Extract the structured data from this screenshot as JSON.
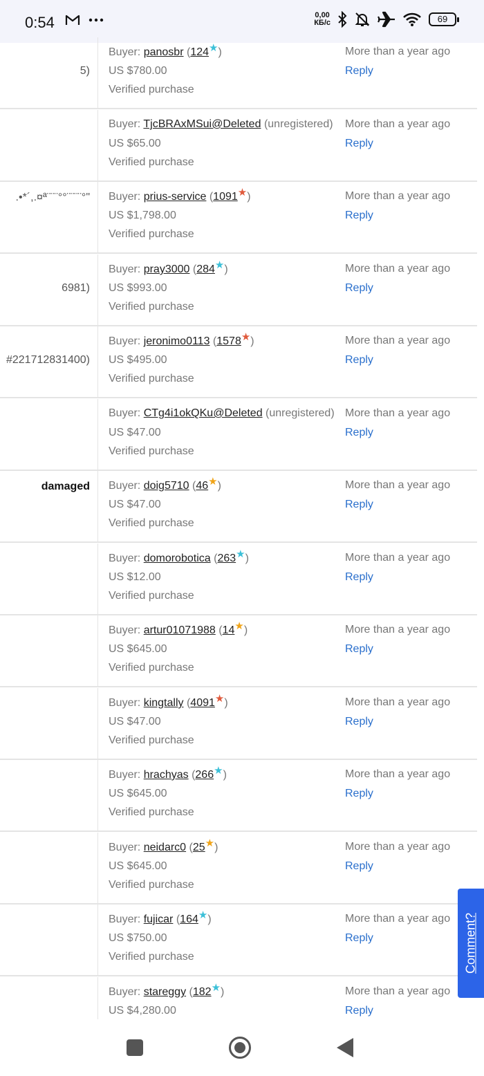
{
  "status_bar": {
    "time": "0:54",
    "net_speed_value": "0,00",
    "net_speed_unit": "КБ/с",
    "battery": "69",
    "icons": [
      "gmail-icon",
      "more-dots-icon",
      "bluetooth-icon",
      "bell-off-icon",
      "airplane-icon",
      "wifi-icon",
      "battery-icon"
    ]
  },
  "star_colors": {
    "teal": "#3cc0d8",
    "red": "#e05a3c",
    "orange": "#f0a418"
  },
  "rows": [
    {
      "left": "5)",
      "buyer_label": "Buyer:",
      "buyer": "panosbr",
      "score": "124",
      "star": "teal",
      "price": "US $780.00",
      "verified": "Verified purchase",
      "when": "More than a year ago",
      "reply": "Reply"
    },
    {
      "left": "",
      "buyer_label": "Buyer:",
      "buyer": "TjcBRAxMSui@Deleted",
      "unregistered": "(unregistered)",
      "price": "US $65.00",
      "verified": "Verified purchase",
      "when": "More than a year ago",
      "reply": "Reply"
    },
    {
      "left": ".•*´,.¤ª¨¨¨°°¨¨¨¨°\"",
      "left_top": true,
      "buyer_label": "Buyer:",
      "buyer": "prius-service",
      "score": "1091",
      "star": "red",
      "price": "US $1,798.00",
      "verified": "Verified purchase",
      "when": "More than a year ago",
      "reply": "Reply"
    },
    {
      "left": "6981)",
      "buyer_label": "Buyer:",
      "buyer": "pray3000",
      "score": "284",
      "star": "teal",
      "price": "US $993.00",
      "verified": "Verified purchase",
      "when": "More than a year ago",
      "reply": "Reply"
    },
    {
      "left": "#221712831400)",
      "buyer_label": "Buyer:",
      "buyer": "jeronimo0113",
      "score": "1578",
      "star": "red",
      "price": "US $495.00",
      "verified": "Verified purchase",
      "when": "More than a year ago",
      "reply": "Reply"
    },
    {
      "left": "",
      "buyer_label": "Buyer:",
      "buyer": "CTg4i1okQKu@Deleted",
      "unregistered": "(unregistered)",
      "price": "US $47.00",
      "verified": "Verified purchase",
      "when": "More than a year ago",
      "reply": "Reply"
    },
    {
      "left": "damaged",
      "left_bold": true,
      "left_top": true,
      "buyer_label": "Buyer:",
      "buyer": "doig5710",
      "score": "46",
      "star": "orange",
      "price": "US $47.00",
      "verified": "Verified purchase",
      "when": "More than a year ago",
      "reply": "Reply"
    },
    {
      "left": "",
      "buyer_label": "Buyer:",
      "buyer": "domorobotica",
      "score": "263",
      "star": "teal",
      "price": "US $12.00",
      "verified": "Verified purchase",
      "when": "More than a year ago",
      "reply": "Reply"
    },
    {
      "left": "",
      "buyer_label": "Buyer:",
      "buyer": "artur01071988",
      "score": "14",
      "star": "orange",
      "price": "US $645.00",
      "verified": "Verified purchase",
      "when": "More than a year ago",
      "reply": "Reply"
    },
    {
      "left": "",
      "buyer_label": "Buyer:",
      "buyer": "kingtally",
      "score": "4091",
      "star": "red",
      "price": "US $47.00",
      "verified": "Verified purchase",
      "when": "More than a year ago",
      "reply": "Reply"
    },
    {
      "left": "",
      "buyer_label": "Buyer:",
      "buyer": "hrachyas",
      "score": "266",
      "star": "teal",
      "price": "US $645.00",
      "verified": "Verified purchase",
      "when": "More than a year ago",
      "reply": "Reply"
    },
    {
      "left": "",
      "buyer_label": "Buyer:",
      "buyer": "neidarc0",
      "score": "25",
      "star": "orange",
      "price": "US $645.00",
      "verified": "Verified purchase",
      "when": "More than a year ago",
      "reply": "Reply"
    },
    {
      "left": "",
      "buyer_label": "Buyer:",
      "buyer": "fujicar",
      "score": "164",
      "star": "teal",
      "price": "US $750.00",
      "verified": "Verified purchase",
      "when": "More than a year ago",
      "reply": "Reply"
    },
    {
      "left": "",
      "buyer_label": "Buyer:",
      "buyer": "stareggy",
      "score": "182",
      "star": "teal",
      "price": "US $4,280.00",
      "verified": "",
      "when": "More than a year ago",
      "reply": "Reply"
    }
  ],
  "comment_button": "Comment?",
  "nav_bar": {
    "icons": [
      "recent-apps-icon",
      "home-icon",
      "back-icon"
    ]
  }
}
